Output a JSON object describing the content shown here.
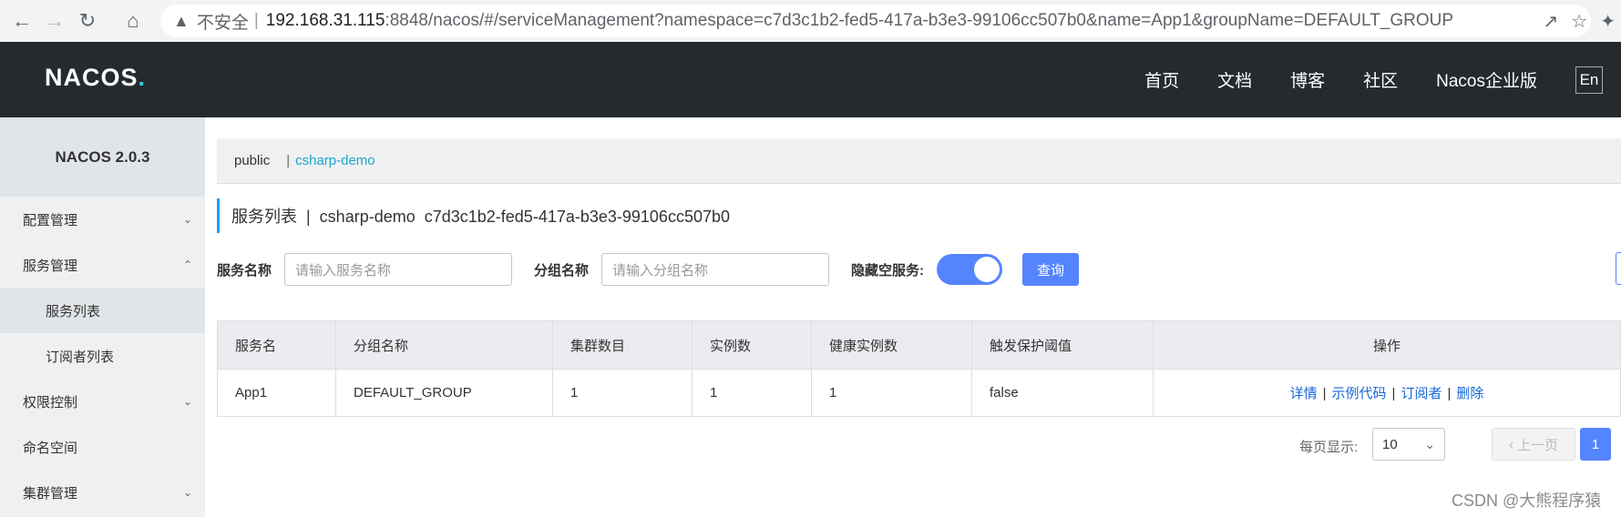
{
  "browser": {
    "warning_text": "不安全",
    "url_host": "192.168.31.115",
    "url_rest": ":8848/nacos/#/serviceManagement?namespace=c7d3c1b2-fed5-417a-b3e3-99106cc507b0&name=App1&groupName=DEFAULT_GROUP"
  },
  "topnav": {
    "logo": "NACOS",
    "logo_dot": ".",
    "items": [
      "首页",
      "文档",
      "博客",
      "社区",
      "Nacos企业版"
    ],
    "lang": "En"
  },
  "sidebar": {
    "title": "NACOS 2.0.3",
    "items": [
      {
        "label": "配置管理"
      },
      {
        "label": "服务管理"
      },
      {
        "label": "服务列表"
      },
      {
        "label": "订阅者列表"
      },
      {
        "label": "权限控制"
      },
      {
        "label": "命名空间"
      },
      {
        "label": "集群管理"
      }
    ]
  },
  "namespaces": {
    "items": [
      "public",
      "csharp-demo"
    ],
    "separator": "|"
  },
  "page": {
    "title": "服务列表  |  csharp-demo  c7d3c1b2-fed5-417a-b3e3-99106cc507b0"
  },
  "filter": {
    "service_label": "服务名称",
    "service_placeholder": "请输入服务名称",
    "group_label": "分组名称",
    "group_placeholder": "请输入分组名称",
    "hide_empty_label": "隐藏空服务:",
    "hide_empty_on": true,
    "query_button": "查询"
  },
  "table": {
    "headers": [
      "服务名",
      "分组名称",
      "集群数目",
      "实例数",
      "健康实例数",
      "触发保护阈值",
      "操作"
    ],
    "rows": [
      {
        "cells": [
          "App1",
          "DEFAULT_GROUP",
          "1",
          "1",
          "1",
          "false"
        ]
      }
    ],
    "ops": [
      "详情",
      "示例代码",
      "订阅者",
      "删除"
    ],
    "op_sep": "|"
  },
  "pagination": {
    "per_page_label": "每页显示:",
    "per_page_value": "10",
    "prev_label": "上一页",
    "current_page": "1"
  },
  "watermark": "CSDN @大熊程序猿"
}
